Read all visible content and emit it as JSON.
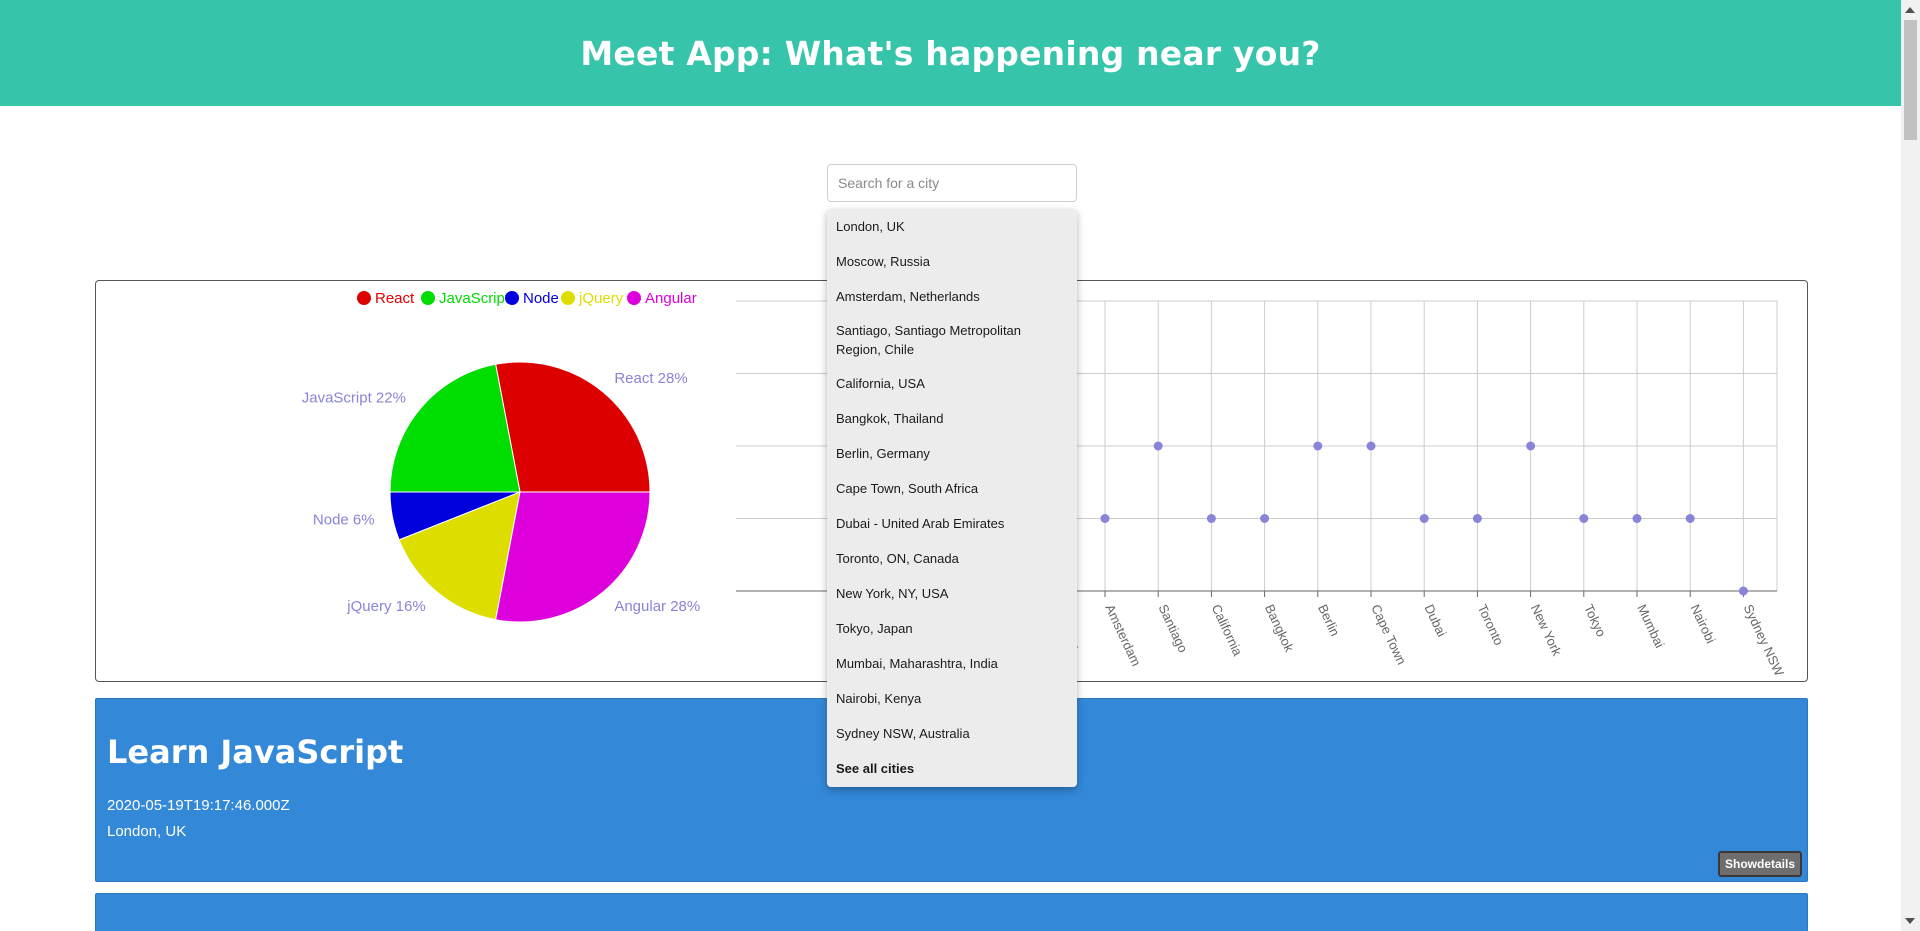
{
  "header": {
    "title": "Meet App: What's happening near you?"
  },
  "search": {
    "placeholder": "Search for a city",
    "value": ""
  },
  "suggestions": [
    "London, UK",
    "Moscow, Russia",
    "Amsterdam, Netherlands",
    "Santiago, Santiago Metropolitan Region, Chile",
    "California, USA",
    "Bangkok, Thailand",
    "Berlin, Germany",
    "Cape Town, South Africa",
    "Dubai - United Arab Emirates",
    "Toronto, ON, Canada",
    "New York, NY, USA",
    "Tokyo, Japan",
    "Mumbai, Maharashtra, India",
    "Nairobi, Kenya",
    "Sydney NSW, Australia"
  ],
  "see_all_label": "See all cities",
  "chart_data": [
    {
      "type": "pie",
      "legend_position": "top",
      "slices": [
        {
          "name": "React",
          "value": 28,
          "color": "#dd0000",
          "label": "React 28%"
        },
        {
          "name": "JavaScript",
          "value": 22,
          "color": "#00dd00",
          "label": "JavaScript 22%"
        },
        {
          "name": "Node",
          "value": 6,
          "color": "#0000dd",
          "label": "Node 6%"
        },
        {
          "name": "jQuery",
          "value": 16,
          "color": "#dddd00",
          "label": "jQuery 16%"
        },
        {
          "name": "Angular",
          "value": 28,
          "color": "#dd00dd",
          "label": "Angular 28%"
        }
      ],
      "label_color": "#8884d8"
    },
    {
      "type": "scatter",
      "grid": true,
      "point_color": "#8884d8",
      "categories": [
        "Moscow",
        "Amsterdam",
        "Santiago",
        "California",
        "Bangkok",
        "Berlin",
        "Cape Town",
        "Dubai",
        "Toronto",
        "New York",
        "Tokyo",
        "Mumbai",
        "Nairobi",
        "Sydney NSW"
      ],
      "values": [
        1,
        1,
        2,
        1,
        1,
        2,
        2,
        1,
        1,
        2,
        1,
        1,
        1,
        0
      ],
      "ylim": [
        0,
        4
      ]
    }
  ],
  "events": [
    {
      "title": "Learn JavaScript",
      "date": "2020-05-19T19:17:46.000Z",
      "location": "London, UK",
      "button": "Showdetails"
    }
  ]
}
